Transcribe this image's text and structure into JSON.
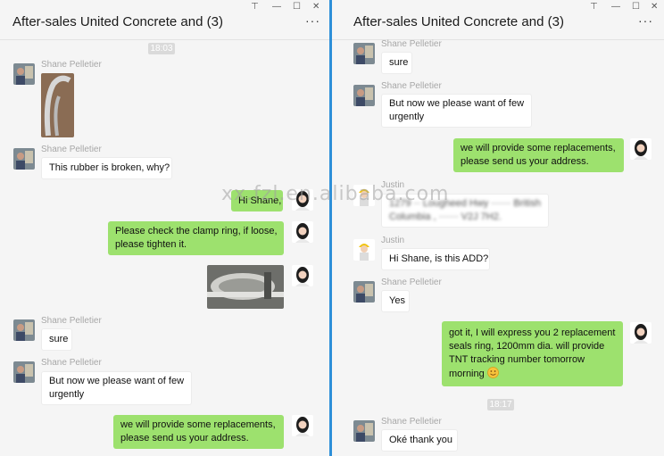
{
  "watermark": "xx.fzl.en.alibaba.com",
  "window_controls": [
    "⊤",
    "—",
    "☐",
    "✕"
  ],
  "left": {
    "title": "After-sales United Concrete and  (3)",
    "more": "···",
    "timestamp": "18:03",
    "messages": [
      {
        "sender": "Shane Pelletier",
        "type": "image"
      },
      {
        "sender": "Shane Pelletier",
        "text": "This rubber is broken, why?"
      },
      {
        "self": true,
        "text": "Hi Shane,"
      },
      {
        "self": true,
        "line1": "Please check the clamp ring, if loose,",
        "line2": "please tighten it."
      },
      {
        "self": true,
        "type": "image"
      },
      {
        "sender": "Shane Pelletier",
        "text": "sure"
      },
      {
        "sender": "Shane Pelletier",
        "line1": "But now we please want of few",
        "line2": "urgently"
      },
      {
        "self": true,
        "line1": "we will provide some replacements,",
        "line2": "please send us your address."
      }
    ]
  },
  "right": {
    "title": "After-sales United Concrete and  (3)",
    "more": "···",
    "timestamp": "18:17",
    "messages": [
      {
        "sender": "Shane Pelletier",
        "text": "sure"
      },
      {
        "sender": "Shane Pelletier",
        "line1": "But now we please want of few",
        "line2": "urgently"
      },
      {
        "self": true,
        "line1": "we will provide some replacements,",
        "line2": "please send us your address."
      },
      {
        "sender": "Justin",
        "line1": "1279 ·· Lougheed Hwy  ······  British",
        "line2": "Columbia ,  ······  V2J 7H2."
      },
      {
        "sender": "Justin",
        "text": "Hi Shane, is this ADD?"
      },
      {
        "sender": "Shane Pelletier",
        "text": "Yes"
      },
      {
        "self": true,
        "line1": "got it, I will express you 2 replacement",
        "line2": "seals ring, 1200mm dia. will provide",
        "line3": "TNT tracking number tomorrow",
        "line4": "morning"
      },
      {
        "sender": "Shane Pelletier",
        "text": "Oké thank you"
      }
    ]
  }
}
